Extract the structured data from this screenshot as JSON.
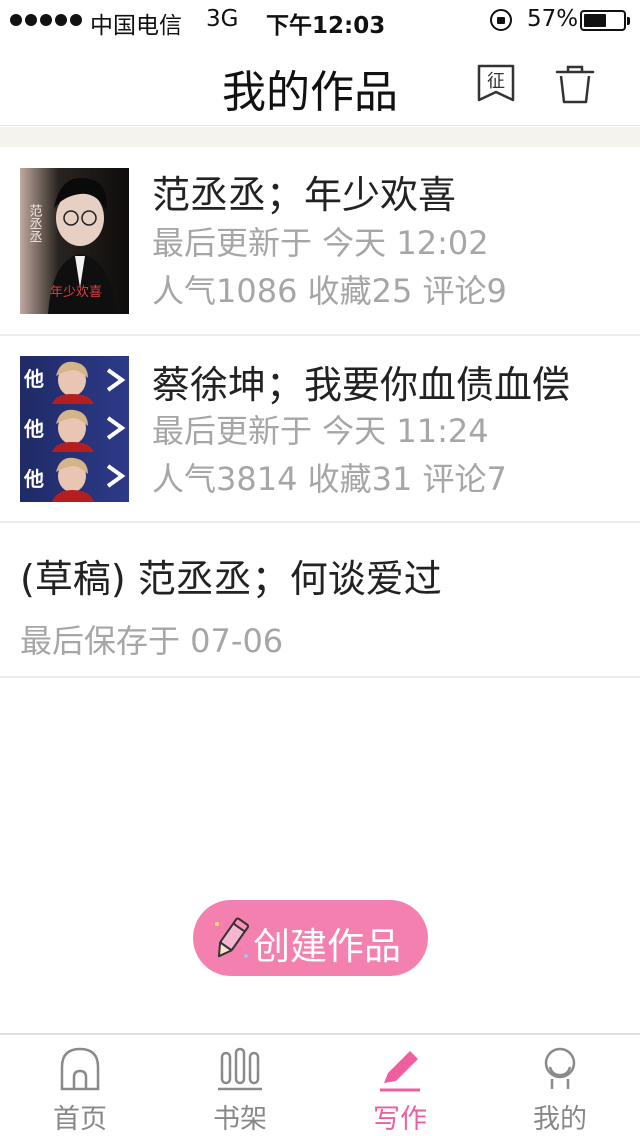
{
  "status_bar": {
    "carrier": "中国电信",
    "network": "3G",
    "time": "下午12:03",
    "battery_percent_text": "57%",
    "battery_level": 0.57
  },
  "nav": {
    "title": "我的作品",
    "contest_icon_text": "征",
    "icons": [
      "contest-icon",
      "trash-icon"
    ]
  },
  "works": [
    {
      "title": "范丞丞；年少欢喜",
      "updated": "最后更新于 今天 12:02",
      "stats": "人气1086 收藏25 评论9",
      "cover_text_side": "范丞丞",
      "cover_text_bottom": "年少欢喜"
    },
    {
      "title": "蔡徐坤；我要你血债血偿",
      "updated": "最后更新于 今天 11:24",
      "stats": "人气3814 收藏31 评论7",
      "cover_text_side": "他"
    }
  ],
  "drafts": [
    {
      "title": "(草稿) 范丞丞；何谈爱过",
      "saved": "最后保存于 07-06"
    }
  ],
  "create_button": {
    "label": "创建作品"
  },
  "tabs": [
    {
      "label": "首页",
      "icon": "home-icon",
      "active": false
    },
    {
      "label": "书架",
      "icon": "bookshelf-icon",
      "active": false
    },
    {
      "label": "写作",
      "icon": "pencil-icon",
      "active": true
    },
    {
      "label": "我的",
      "icon": "profile-icon",
      "active": false
    }
  ],
  "colors": {
    "accent_pink": "#f480b0",
    "active_tab": "#ef5fa0",
    "meta_gray": "#a6a6a6"
  }
}
